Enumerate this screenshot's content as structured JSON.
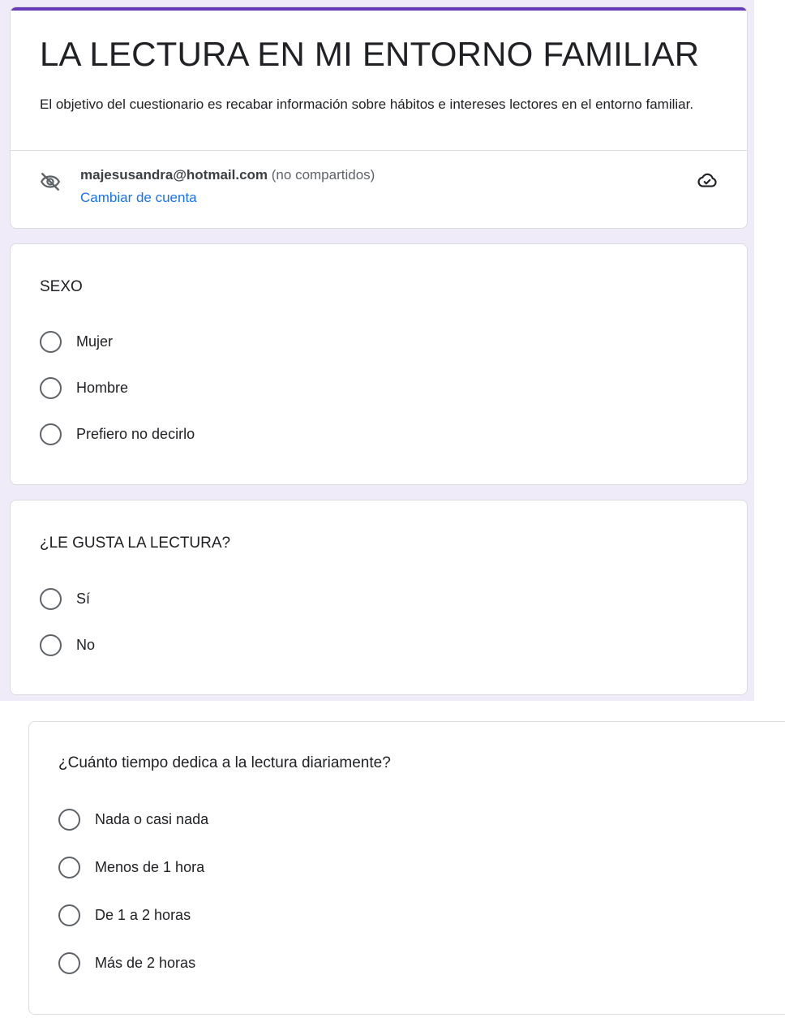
{
  "form": {
    "title": "LA LECTURA EN MI ENTORNO FAMILIAR",
    "description": "El objetivo del cuestionario es recabar información sobre hábitos e intereses lectores en el entorno familiar.",
    "accent_color": "#673ab7",
    "background_color": "#f0ebf8"
  },
  "account": {
    "email": "majesusandra@hotmail.com",
    "sharing_status": " (no compartidos)",
    "switch_account_label": "Cambiar de cuenta",
    "link_color": "#1a73e8",
    "icons": [
      "eye-off-icon",
      "cloud-check-icon"
    ]
  },
  "questions": [
    {
      "title": "SEXO",
      "options": [
        "Mujer",
        "Hombre",
        "Prefiero no decirlo"
      ]
    },
    {
      "title": "¿LE GUSTA LA LECTURA?",
      "options": [
        "Sí",
        "No"
      ]
    },
    {
      "title": "¿Cuánto tiempo dedica a la lectura diariamente?",
      "options": [
        "Nada o casi nada",
        "Menos de 1 hora",
        "De 1 a 2 horas",
        "Más de 2 horas"
      ]
    }
  ]
}
